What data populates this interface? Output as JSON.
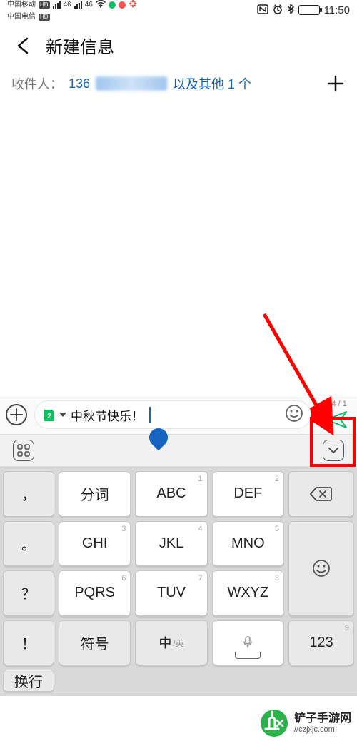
{
  "status": {
    "carrier1": "中国移动",
    "carrier2": "中国电信",
    "sig_label": "46",
    "time": "11:50"
  },
  "header": {
    "title": "新建信息"
  },
  "recipient": {
    "label": "收件人：",
    "number": "136",
    "suffix": "以及其他 1 个"
  },
  "input": {
    "message": "中秋节快乐！",
    "char_count": "64 / 1"
  },
  "keyboard": {
    "punct": {
      "comma": "，",
      "period": "。",
      "question": "？",
      "exclaim": "！"
    },
    "r1": {
      "k1": "分词",
      "k2": "ABC",
      "k3": "DEF"
    },
    "r2": {
      "k1": "GHI",
      "k2": "JKL",
      "k3": "MNO"
    },
    "r3": {
      "k1": "PQRS",
      "k2": "TUV",
      "k3": "WXYZ"
    },
    "r4": {
      "symbols": "符号",
      "mode_zh": "中",
      "mode_en": "/英",
      "numbers": "123",
      "enter": "换行"
    },
    "superscripts": {
      "abc": "1",
      "def": "2",
      "ghi": "3",
      "jkl": "4",
      "mno": "5",
      "pqrs": "6",
      "tuv": "7",
      "wxyz": "8",
      "num": "9"
    }
  },
  "watermark": {
    "name": "铲子手游网",
    "url": "//czjxjc.com"
  }
}
